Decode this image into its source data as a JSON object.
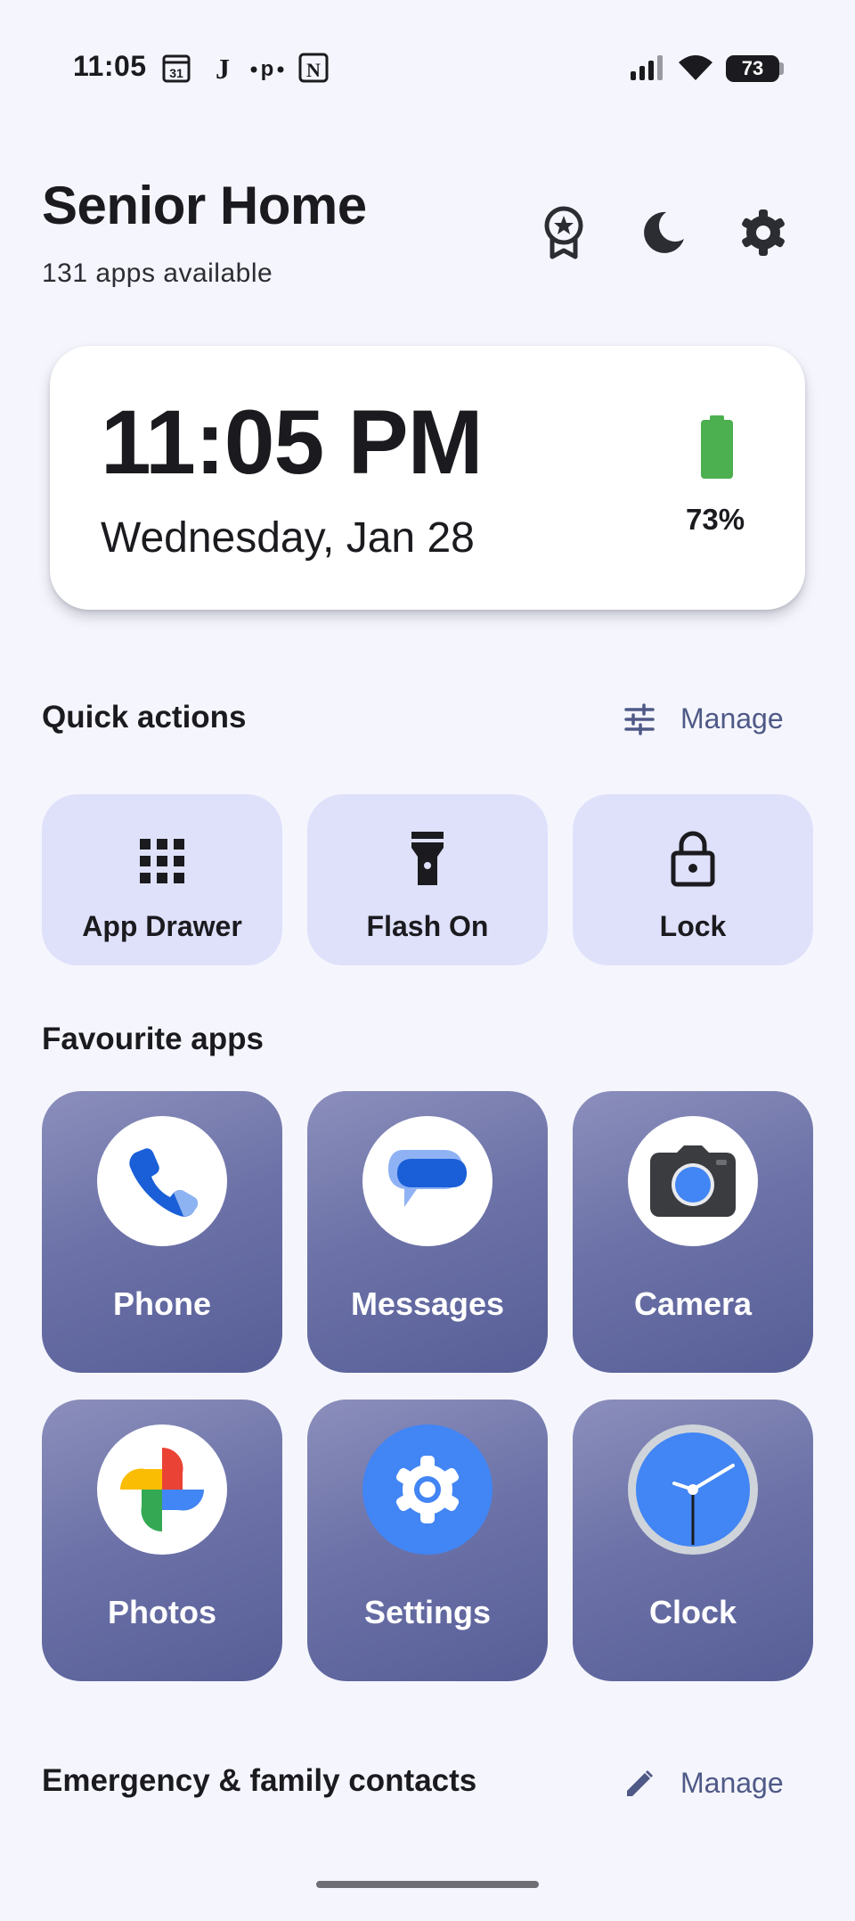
{
  "status_bar": {
    "time": "11:05",
    "notification_icons": [
      "calendar-icon",
      "j-app-icon",
      "p-app-icon",
      "notion-icon"
    ],
    "signal_icon": "signal-icon",
    "wifi_icon": "wifi-icon",
    "battery_text": "73"
  },
  "header": {
    "title": "Senior Home",
    "subtitle": "131 apps available",
    "actions": [
      "award-icon",
      "dark-mode-icon",
      "settings-icon"
    ]
  },
  "clock_card": {
    "time": "11:05 PM",
    "date": "Wednesday, Jan 28",
    "battery_percent": "73%",
    "battery_level": 0.73,
    "battery_color": "#4caf50"
  },
  "quick_actions": {
    "title": "Quick actions",
    "manage_label": "Manage",
    "items": [
      {
        "label": "App Drawer",
        "icon": "grid-icon"
      },
      {
        "label": "Flash On",
        "icon": "flashlight-icon"
      },
      {
        "label": "Lock",
        "icon": "lock-icon"
      }
    ]
  },
  "favourite_apps": {
    "title": "Favourite apps",
    "items": [
      {
        "label": "Phone",
        "icon": "phone-icon"
      },
      {
        "label": "Messages",
        "icon": "messages-icon"
      },
      {
        "label": "Camera",
        "icon": "camera-icon"
      },
      {
        "label": "Photos",
        "icon": "photos-icon"
      },
      {
        "label": "Settings",
        "icon": "settings-app-icon"
      },
      {
        "label": "Clock",
        "icon": "clock-app-icon"
      }
    ]
  },
  "emergency_contacts": {
    "title": "Emergency & family contacts",
    "manage_label": "Manage"
  },
  "colors": {
    "background": "#f5f6fd",
    "accent": "#4f5987",
    "tile": "#dfe1fb",
    "app_tile": "#6d73a8"
  }
}
